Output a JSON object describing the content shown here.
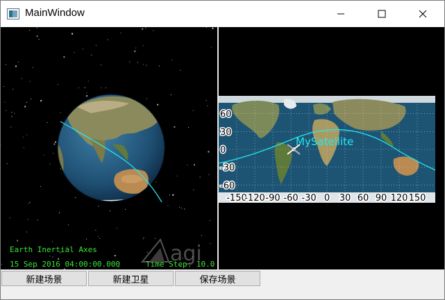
{
  "window": {
    "title": "MainWindow"
  },
  "view3d": {
    "axes_label": "Earth Inertial Axes",
    "datetime": "15 Sep 2016 04:00:00.000",
    "time_step": "Time Step: 10.0",
    "watermark": "agi"
  },
  "view2d": {
    "satellite_name": "MySatellite",
    "lat_ticks": [
      "60",
      "30",
      "0",
      "-30",
      "-60"
    ],
    "lon_ticks": [
      "-150",
      "-120",
      "-90",
      "-60",
      "-30",
      "0",
      "30",
      "60",
      "90",
      "120",
      "150"
    ]
  },
  "buttons": {
    "new_scene": "新建场景",
    "new_satellite": "新建卫星",
    "save_scene": "保存场景"
  },
  "colors": {
    "orbit": "#22e8f0",
    "overlay_text": "#39e639"
  }
}
